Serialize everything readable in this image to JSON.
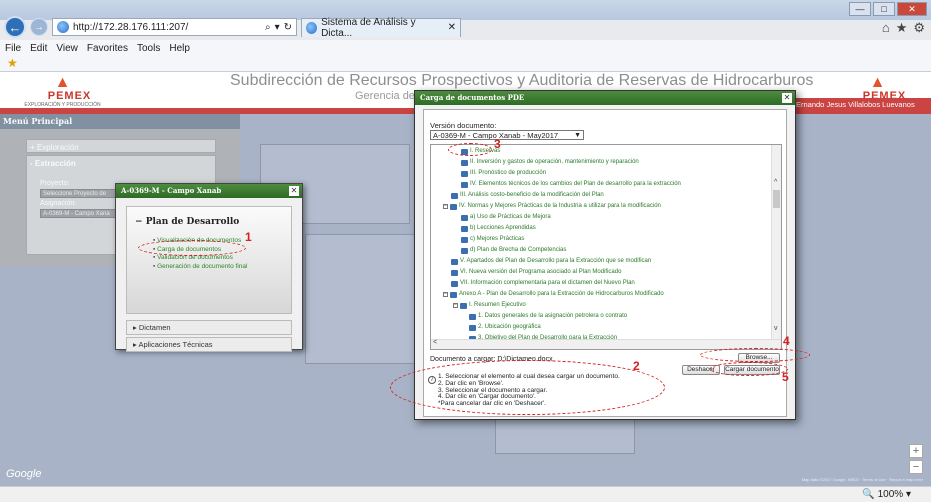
{
  "browser": {
    "address": "http://172.28.176.111:207/",
    "tab_title": "Sistema de Análisis y Dicta...",
    "menu": [
      "File",
      "Edit",
      "View",
      "Favorites",
      "Tools",
      "Help"
    ],
    "zoom": "100%"
  },
  "header": {
    "logo_name": "PEMEX",
    "logo_sub": "EXPLORACIÓN Y PRODUCCIÓN",
    "title": "Subdirección de Recursos Prospectivos y Auditoria de Reservas de Hidrocarburos",
    "subtitle": "Gerencia de",
    "user": "Ernando Jesus Villalobos Luevanos"
  },
  "left_menu": {
    "title": "Menú Principal",
    "exploracion": "+ Exploración",
    "extraccion": "- Extracción",
    "proyecto_label": "Proyecto:",
    "proyecto_value": "Seleccione Proyecto de",
    "asignacion_label": "Asignación:",
    "asignacion_value": "A-0369-M - Campo Xana"
  },
  "popup": {
    "title": "A-0369-M - Campo Xanab",
    "plan_title": "Plan de Desarrollo",
    "items": [
      "Visualización de documentos",
      "Carga de documentos",
      "Validación de documentos",
      "Generación de documento final"
    ],
    "dictamen": "Dictamen",
    "aplicaciones": "Aplicaciones Técnicas"
  },
  "dialog": {
    "title": "Carga de documentos PDE",
    "version_label": "Versión documento:",
    "version_value": "A-0369-M - Campo Xanab - May2017",
    "tree": [
      "I. Reservas",
      "II. Inversión y gastos de operación, mantenimiento y reparación",
      "III. Pronóstico de producción",
      "IV. Elementos técnicos de los cambios del Plan de desarrollo para la extracción",
      "III. Análisis costo-beneficio de la modificación del Plan",
      "IV. Normas y Mejores Prácticas de la Industria a utilizar para la modificación",
      "a) Uso de Prácticas de Mejora",
      "b) Lecciones Aprendidas",
      "c) Mejores Prácticas",
      "d) Plan de Brecha de Competencias",
      "V. Apartados del Plan de Desarrollo para la Extracción que se modifican",
      "VI. Nueva versión del Programa asociado al Plan Modificado",
      "VII. Información complementaria para el dictamen del Nuevo Plan",
      "Anexo A - Plan de Desarrollo para la Extracción de Hidrocarburos Modificado",
      "I. Resumen Ejecutivo",
      "1. Datos generales de la asignación petrolera o contrato",
      "2. Ubicación geográfica",
      "3. Objetivo del Plan de Desarrollo para la Extracción"
    ],
    "doc_label": "Documento a cargar:",
    "doc_value": "D:\\Dictamen.docx",
    "browse": "Browse...",
    "undo": "Deshacer",
    "upload": "Cargar documento",
    "instructions": [
      "1. Seleccionar el elemento al cual desea cargar un documento.",
      "2. Dar clic en 'Browse'.",
      "3. Seleccionar el documento a cargar.",
      "4. Dar clic en 'Cargar documento'.",
      "*Para cancelar dar clic en 'Deshacer'."
    ]
  },
  "annotations": [
    "1",
    "2",
    "3",
    "4",
    "5"
  ],
  "map": {
    "google": "Google",
    "attribution": "Map data ©2017 Google, INEGI · Terms of Use · Report a map error"
  },
  "colors": {
    "brand_red": "#c94442",
    "window_green": "#2e6b25",
    "link_green": "#2a8a2a",
    "annotation_red": "#d42020"
  }
}
